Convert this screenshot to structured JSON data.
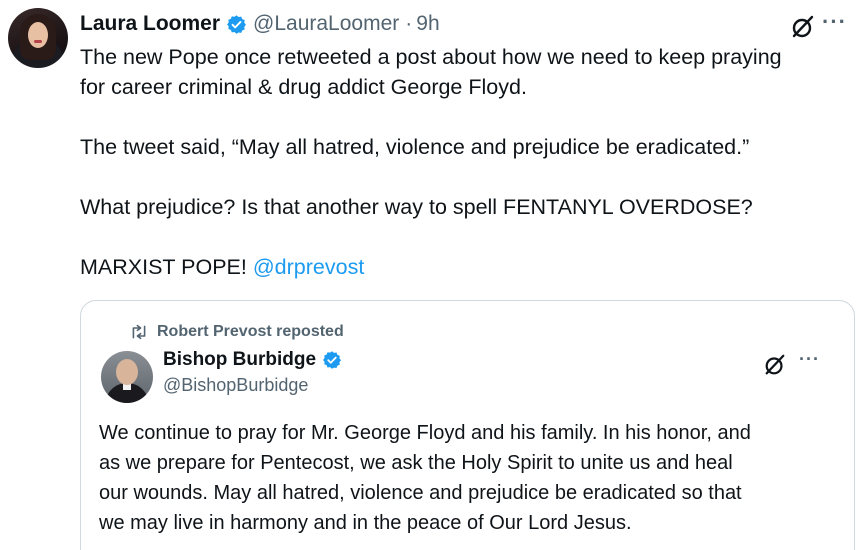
{
  "tweet": {
    "author_name": "Laura Loomer",
    "author_handle": "@LauraLoomer",
    "separator": "·",
    "time": "9h",
    "lines": [
      "The new Pope once retweeted a post about how we need to keep praying",
      "for career criminal & drug addict George Floyd.",
      "",
      "The tweet said, “May all hatred, violence and prejudice be eradicated.”",
      "",
      "What prejudice? Is that another way to spell FENTANYL OVERDOSE?",
      ""
    ],
    "last_line_text": "MARXIST POPE!",
    "mention": "@drprevost",
    "icons": {
      "verified": "verified-badge-icon",
      "grok": "grok-icon",
      "more": "more-options-icon"
    }
  },
  "quoted": {
    "repost_label": "Robert Prevost reposted",
    "author_name": "Bishop Burbidge",
    "author_handle": "@BishopBurbidge",
    "lines": [
      "We continue to pray for Mr. George Floyd and his family. In his honor, and",
      "as we prepare for Pentecost, we ask the Holy Spirit to unite us and heal",
      "our wounds. May all hatred, violence and prejudice be eradicated so that",
      "we may live in harmony and in the peace of Our Lord Jesus."
    ],
    "icons": {
      "repost": "repost-icon",
      "verified": "verified-badge-icon",
      "grok": "grok-icon",
      "more": "more-options-icon"
    }
  },
  "colors": {
    "text": "#0f1419",
    "secondary": "#536471",
    "accent": "#1d9bf0",
    "border": "#cfd9de"
  }
}
